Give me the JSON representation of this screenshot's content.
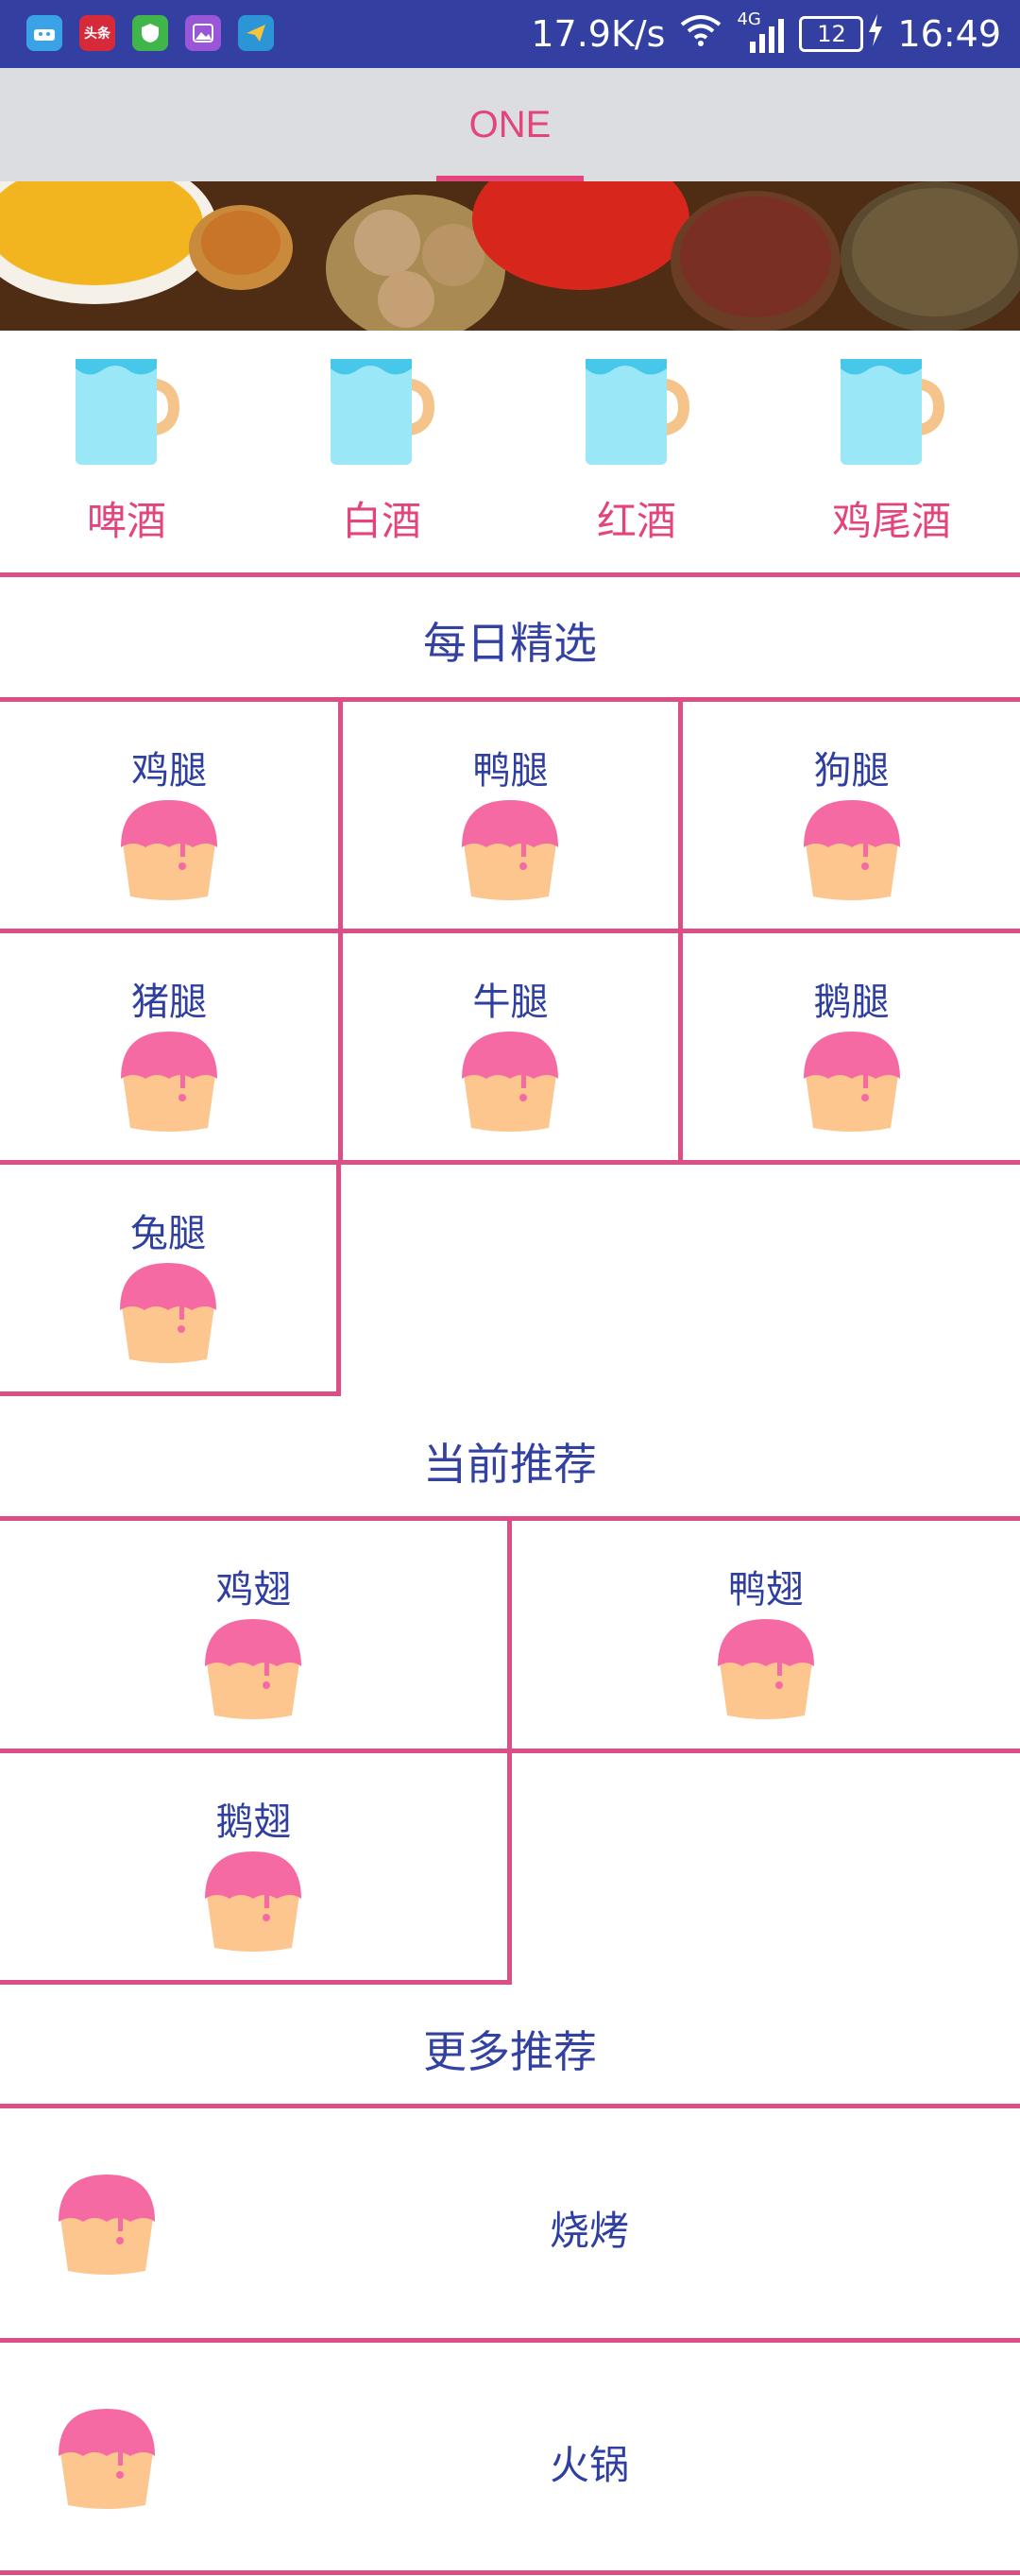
{
  "status_bar": {
    "speed": "17.9K/s",
    "network": "4G",
    "battery": "12",
    "time": "16:49",
    "app_icons": [
      "android-app-icon",
      "toutiao-icon",
      "shield-app-icon",
      "gallery-app-icon",
      "paper-plane-app-icon"
    ],
    "toutiao_text": "头条"
  },
  "tabs": [
    {
      "label": "ONE",
      "active": true
    }
  ],
  "drinks": [
    "啤酒",
    "白酒",
    "红酒",
    "鸡尾酒"
  ],
  "sections": {
    "daily": {
      "title": "每日精选",
      "items": [
        "鸡腿",
        "鸭腿",
        "狗腿",
        "猪腿",
        "牛腿",
        "鹅腿",
        "兔腿"
      ]
    },
    "current": {
      "title": "当前推荐",
      "items": [
        "鸡翅",
        "鸭翅",
        "鹅翅"
      ]
    },
    "more": {
      "title": "更多推荐",
      "items": [
        "烧烤",
        "火锅"
      ]
    }
  },
  "colors": {
    "accent": "#e3447c",
    "primary": "#3340a1",
    "divider": "#db4f86"
  }
}
